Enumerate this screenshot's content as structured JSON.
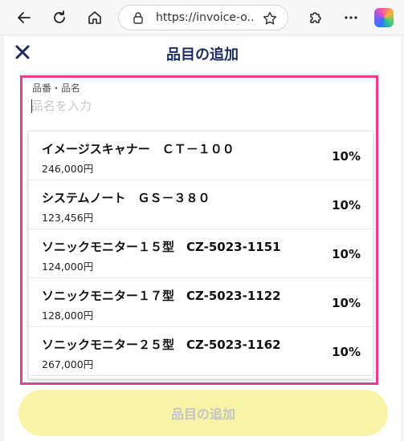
{
  "browser": {
    "url": "https://invoice-o..."
  },
  "app": {
    "title": "品目の追加",
    "search": {
      "label": "品番・品名",
      "placeholder": "品名を入力"
    },
    "items": [
      {
        "name": "イメージスキャナー　ＣＴ－１００",
        "price": "246,000円",
        "tax": "10%"
      },
      {
        "name": "システムノート　ＧＳ－３８０",
        "price": "123,456円",
        "tax": "10%"
      },
      {
        "name": "ソニックモニター１５型　CZ-5023-1151",
        "price": "124,000円",
        "tax": "10%"
      },
      {
        "name": "ソニックモニター１７型　CZ-5023-1122",
        "price": "128,000円",
        "tax": "10%"
      },
      {
        "name": "ソニックモニター２５型　CZ-5023-1162",
        "price": "267,000円",
        "tax": "10%"
      }
    ],
    "submit_label": "品目の追加"
  },
  "colors": {
    "highlight": "#ec3b93",
    "title": "#1e2a5e",
    "submit_bg": "#f8f3a6"
  }
}
